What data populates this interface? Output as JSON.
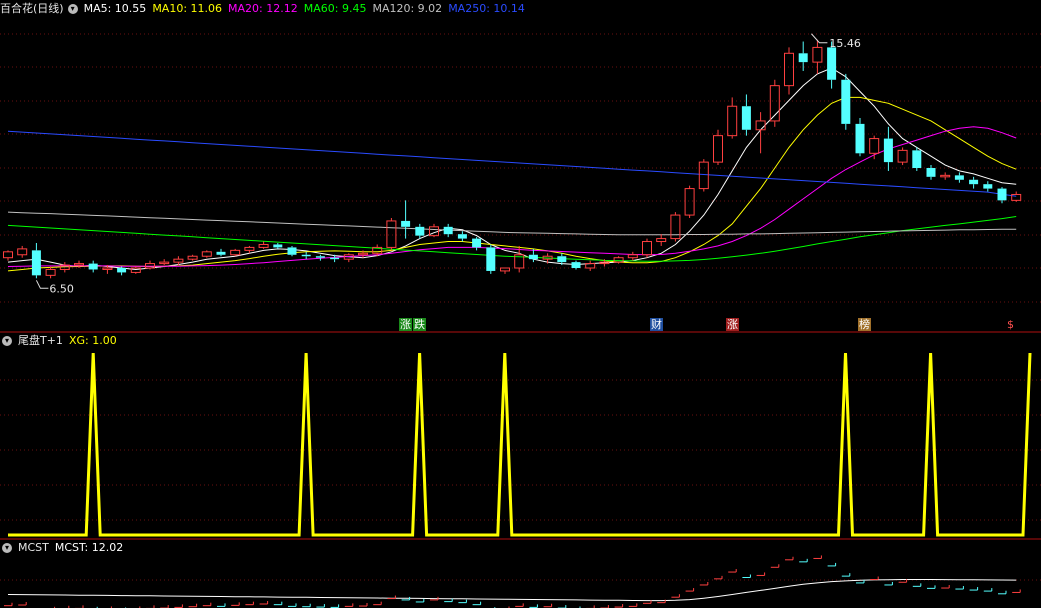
{
  "main_panel": {
    "title": "百合花(日线)",
    "ma": [
      {
        "label": "MA5: 10.55",
        "color": "#ffffff"
      },
      {
        "label": "MA10: 11.06",
        "color": "#ffff00"
      },
      {
        "label": "MA20: 12.12",
        "color": "#ff00ff"
      },
      {
        "label": "MA60: 9.45",
        "color": "#00ff00"
      },
      {
        "label": "MA120: 9.02",
        "color": "#c0c0c0"
      },
      {
        "label": "MA250: 10.14",
        "color": "#2a4bff"
      }
    ],
    "high_label": "15.46",
    "low_label": "6.50",
    "events": [
      {
        "text": "涨",
        "color": "#ffffff",
        "bg": "#1a8a1a"
      },
      {
        "text": "跌",
        "color": "#ffffff",
        "bg": "#1a8a1a"
      },
      {
        "text": "财",
        "color": "#ffffff",
        "bg": "#1f4fa0"
      },
      {
        "text": "涨",
        "color": "#ffffff",
        "bg": "#a01f1f"
      },
      {
        "text": "榜",
        "color": "#ffffff",
        "bg": "#a0702a"
      },
      {
        "text": "$",
        "color": "#ff5050",
        "bg": "#000000"
      }
    ]
  },
  "indicator_panel": {
    "title": "尾盘T+1",
    "value_label": "XG: 1.00",
    "value_color": "#ffff00"
  },
  "mcst_panel": {
    "title": "MCST",
    "value_label": "MCST: 12.02",
    "value_color": "#ffffff"
  },
  "chart_data": {
    "type": "candlestick",
    "up_color": "#ff4040",
    "down_color": "#54ffff",
    "ylim": [
      6.0,
      16.2
    ],
    "candles": [
      [
        8.05,
        8.3,
        7.95,
        8.25
      ],
      [
        8.15,
        8.45,
        8.05,
        8.35
      ],
      [
        8.3,
        8.55,
        7.35,
        7.45
      ],
      [
        7.45,
        7.75,
        7.35,
        7.65
      ],
      [
        7.65,
        7.9,
        7.55,
        7.8
      ],
      [
        7.8,
        7.95,
        7.7,
        7.85
      ],
      [
        7.85,
        7.95,
        7.55,
        7.65
      ],
      [
        7.65,
        7.8,
        7.5,
        7.7
      ],
      [
        7.7,
        7.75,
        7.45,
        7.55
      ],
      [
        7.55,
        7.75,
        7.5,
        7.7
      ],
      [
        7.7,
        7.95,
        7.65,
        7.85
      ],
      [
        7.85,
        8.0,
        7.8,
        7.9
      ],
      [
        7.9,
        8.1,
        7.8,
        8.0
      ],
      [
        8.0,
        8.15,
        7.95,
        8.1
      ],
      [
        8.1,
        8.3,
        8.05,
        8.25
      ],
      [
        8.25,
        8.35,
        8.1,
        8.15
      ],
      [
        8.15,
        8.35,
        8.1,
        8.3
      ],
      [
        8.3,
        8.45,
        8.2,
        8.4
      ],
      [
        8.4,
        8.6,
        8.35,
        8.5
      ],
      [
        8.5,
        8.55,
        8.35,
        8.4
      ],
      [
        8.4,
        8.45,
        8.1,
        8.15
      ],
      [
        8.15,
        8.25,
        8.0,
        8.1
      ],
      [
        8.1,
        8.15,
        7.95,
        8.05
      ],
      [
        8.05,
        8.15,
        7.9,
        8.0
      ],
      [
        8.0,
        8.2,
        7.9,
        8.15
      ],
      [
        8.15,
        8.3,
        8.05,
        8.2
      ],
      [
        8.2,
        8.5,
        8.1,
        8.4
      ],
      [
        8.4,
        9.4,
        8.3,
        9.3
      ],
      [
        9.3,
        10.0,
        8.7,
        9.1
      ],
      [
        9.1,
        9.2,
        8.7,
        8.8
      ],
      [
        8.8,
        9.2,
        8.75,
        9.1
      ],
      [
        9.1,
        9.2,
        8.75,
        8.85
      ],
      [
        8.85,
        8.95,
        8.6,
        8.7
      ],
      [
        8.7,
        8.75,
        8.3,
        8.4
      ],
      [
        8.4,
        8.5,
        7.5,
        7.6
      ],
      [
        7.6,
        7.7,
        7.5,
        7.7
      ],
      [
        7.7,
        8.45,
        7.55,
        8.15
      ],
      [
        8.15,
        8.35,
        7.9,
        8.0
      ],
      [
        8.0,
        8.2,
        7.85,
        8.1
      ],
      [
        8.1,
        8.2,
        7.8,
        7.9
      ],
      [
        7.9,
        7.95,
        7.65,
        7.7
      ],
      [
        7.7,
        7.95,
        7.6,
        7.85
      ],
      [
        7.85,
        8.0,
        7.75,
        7.9
      ],
      [
        7.9,
        8.1,
        7.85,
        8.05
      ],
      [
        8.05,
        8.25,
        7.95,
        8.15
      ],
      [
        8.15,
        8.7,
        8.05,
        8.6
      ],
      [
        8.6,
        8.85,
        8.45,
        8.7
      ],
      [
        8.7,
        9.6,
        8.6,
        9.5
      ],
      [
        9.5,
        10.5,
        9.4,
        10.4
      ],
      [
        10.4,
        11.4,
        10.3,
        11.3
      ],
      [
        11.3,
        12.4,
        11.2,
        12.2
      ],
      [
        12.2,
        13.5,
        12.1,
        13.2
      ],
      [
        13.2,
        13.6,
        12.2,
        12.4
      ],
      [
        12.4,
        13.0,
        11.6,
        12.7
      ],
      [
        12.7,
        14.1,
        12.5,
        13.9
      ],
      [
        13.9,
        15.2,
        13.6,
        15.0
      ],
      [
        15.0,
        15.4,
        14.4,
        14.7
      ],
      [
        14.7,
        15.46,
        14.3,
        15.2
      ],
      [
        15.2,
        15.4,
        13.8,
        14.1
      ],
      [
        14.1,
        14.3,
        12.4,
        12.6
      ],
      [
        12.6,
        12.8,
        11.5,
        11.6
      ],
      [
        11.6,
        12.2,
        11.4,
        12.1
      ],
      [
        12.1,
        12.5,
        11.0,
        11.3
      ],
      [
        11.3,
        11.8,
        11.2,
        11.7
      ],
      [
        11.7,
        11.8,
        11.0,
        11.1
      ],
      [
        11.1,
        11.2,
        10.7,
        10.8
      ],
      [
        10.8,
        10.95,
        10.7,
        10.85
      ],
      [
        10.85,
        10.95,
        10.6,
        10.7
      ],
      [
        10.7,
        10.8,
        10.4,
        10.55
      ],
      [
        10.55,
        10.65,
        10.3,
        10.4
      ],
      [
        10.4,
        10.45,
        9.9,
        10.0
      ],
      [
        10.0,
        10.3,
        9.95,
        10.2
      ]
    ],
    "moving_averages": [
      {
        "name": "MA5",
        "color": "#ffffff",
        "values": [
          7.9,
          7.95,
          8.0,
          7.9,
          7.8,
          7.75,
          7.8,
          7.75,
          7.7,
          7.65,
          7.7,
          7.75,
          7.82,
          7.9,
          8.0,
          8.05,
          8.1,
          8.2,
          8.3,
          8.35,
          8.33,
          8.28,
          8.2,
          8.12,
          8.08,
          8.05,
          8.12,
          8.25,
          8.45,
          8.7,
          8.9,
          9.05,
          9.0,
          8.8,
          8.5,
          8.3,
          8.2,
          8.0,
          7.9,
          7.85,
          7.82,
          7.85,
          7.88,
          7.9,
          7.95,
          8.05,
          8.2,
          8.5,
          8.95,
          9.5,
          10.2,
          11.0,
          11.8,
          12.4,
          12.9,
          13.4,
          13.9,
          14.3,
          14.5,
          14.2,
          13.7,
          13.2,
          12.6,
          12.1,
          11.8,
          11.5,
          11.2,
          11.0,
          10.9,
          10.75,
          10.6,
          10.55
        ]
      },
      {
        "name": "MA10",
        "color": "#ffff00",
        "values": [
          7.6,
          7.65,
          7.7,
          7.72,
          7.74,
          7.75,
          7.76,
          7.77,
          7.77,
          7.76,
          7.75,
          7.76,
          7.77,
          7.8,
          7.85,
          7.9,
          7.95,
          8.02,
          8.1,
          8.17,
          8.22,
          8.25,
          8.27,
          8.28,
          8.27,
          8.25,
          8.25,
          8.3,
          8.4,
          8.5,
          8.55,
          8.6,
          8.6,
          8.55,
          8.5,
          8.45,
          8.4,
          8.35,
          8.28,
          8.2,
          8.1,
          8.02,
          7.95,
          7.9,
          7.88,
          7.88,
          7.92,
          8.05,
          8.25,
          8.5,
          8.8,
          9.2,
          9.8,
          10.4,
          11.1,
          11.8,
          12.4,
          12.9,
          13.3,
          13.5,
          13.5,
          13.4,
          13.3,
          13.1,
          12.9,
          12.7,
          12.4,
          12.1,
          11.8,
          11.5,
          11.25,
          11.06
        ]
      },
      {
        "name": "MA20",
        "color": "#ff00ff",
        "values": [
          7.75,
          7.76,
          7.77,
          7.77,
          7.77,
          7.77,
          7.77,
          7.77,
          7.76,
          7.76,
          7.76,
          7.76,
          7.76,
          7.77,
          7.78,
          7.8,
          7.82,
          7.85,
          7.88,
          7.92,
          7.96,
          8.0,
          8.03,
          8.06,
          8.09,
          8.12,
          8.15,
          8.2,
          8.26,
          8.32,
          8.36,
          8.4,
          8.4,
          8.4,
          8.38,
          8.36,
          8.33,
          8.3,
          8.28,
          8.26,
          8.24,
          8.22,
          8.2,
          8.18,
          8.16,
          8.15,
          8.16,
          8.2,
          8.27,
          8.35,
          8.45,
          8.6,
          8.8,
          9.05,
          9.35,
          9.7,
          10.05,
          10.4,
          10.75,
          11.05,
          11.3,
          11.55,
          11.75,
          11.9,
          12.05,
          12.2,
          12.35,
          12.45,
          12.5,
          12.45,
          12.3,
          12.12
        ]
      },
      {
        "name": "MA60",
        "color": "#00ff00",
        "values": [
          9.15,
          9.12,
          9.09,
          9.06,
          9.03,
          9.0,
          8.97,
          8.94,
          8.91,
          8.88,
          8.85,
          8.82,
          8.79,
          8.76,
          8.73,
          8.7,
          8.67,
          8.64,
          8.61,
          8.58,
          8.55,
          8.52,
          8.49,
          8.46,
          8.43,
          8.4,
          8.37,
          8.34,
          8.31,
          8.28,
          8.25,
          8.22,
          8.19,
          8.16,
          8.13,
          8.1,
          8.08,
          8.06,
          8.04,
          8.02,
          8.0,
          7.98,
          7.96,
          7.95,
          7.94,
          7.93,
          7.93,
          7.94,
          7.96,
          7.99,
          8.03,
          8.08,
          8.14,
          8.2,
          8.27,
          8.35,
          8.43,
          8.52,
          8.6,
          8.68,
          8.76,
          8.83,
          8.9,
          8.97,
          9.03,
          9.09,
          9.15,
          9.2,
          9.26,
          9.32,
          9.38,
          9.45
        ]
      },
      {
        "name": "MA120",
        "color": "#c0c0c0",
        "values": [
          9.6,
          9.58,
          9.56,
          9.55,
          9.53,
          9.51,
          9.49,
          9.47,
          9.45,
          9.43,
          9.41,
          9.39,
          9.37,
          9.35,
          9.33,
          9.31,
          9.29,
          9.27,
          9.25,
          9.23,
          9.21,
          9.19,
          9.17,
          9.15,
          9.13,
          9.11,
          9.09,
          9.07,
          9.05,
          9.03,
          9.01,
          8.99,
          8.97,
          8.95,
          8.93,
          8.91,
          8.9,
          8.89,
          8.88,
          8.87,
          8.86,
          8.85,
          8.84,
          8.83,
          8.83,
          8.83,
          8.83,
          8.83,
          8.84,
          8.84,
          8.85,
          8.85,
          8.86,
          8.86,
          8.87,
          8.88,
          8.89,
          8.9,
          8.91,
          8.92,
          8.93,
          8.94,
          8.95,
          8.96,
          8.97,
          8.98,
          8.99,
          9.0,
          9.0,
          9.01,
          9.02,
          9.02
        ]
      },
      {
        "name": "MA250",
        "color": "#2a4bff",
        "values": [
          12.35,
          12.32,
          12.29,
          12.26,
          12.23,
          12.2,
          12.17,
          12.14,
          12.11,
          12.08,
          12.05,
          12.02,
          11.99,
          11.96,
          11.93,
          11.9,
          11.87,
          11.84,
          11.81,
          11.78,
          11.75,
          11.72,
          11.69,
          11.66,
          11.63,
          11.6,
          11.57,
          11.54,
          11.51,
          11.48,
          11.45,
          11.42,
          11.39,
          11.36,
          11.33,
          11.3,
          11.27,
          11.24,
          11.21,
          11.18,
          11.15,
          11.12,
          11.09,
          11.06,
          11.03,
          11.0,
          10.97,
          10.94,
          10.91,
          10.88,
          10.85,
          10.82,
          10.79,
          10.76,
          10.73,
          10.7,
          10.67,
          10.64,
          10.61,
          10.58,
          10.55,
          10.52,
          10.49,
          10.46,
          10.43,
          10.4,
          10.37,
          10.34,
          10.31,
          10.28,
          10.21,
          10.14
        ]
      }
    ],
    "xg_signal_days": [
      6,
      21,
      29,
      35,
      59,
      65,
      72
    ],
    "xg_total_days": 73,
    "mcst": [
      9.9,
      9.88,
      9.86,
      9.84,
      9.82,
      9.8,
      9.78,
      9.76,
      9.74,
      9.72,
      9.7,
      9.68,
      9.66,
      9.64,
      9.62,
      9.6,
      9.58,
      9.56,
      9.54,
      9.52,
      9.5,
      9.48,
      9.46,
      9.44,
      9.42,
      9.4,
      9.38,
      9.36,
      9.34,
      9.32,
      9.3,
      9.28,
      9.26,
      9.24,
      9.22,
      9.2,
      9.18,
      9.16,
      9.14,
      9.12,
      9.1,
      9.08,
      9.06,
      9.04,
      9.02,
      9.0,
      9.0,
      9.05,
      9.15,
      9.35,
      9.6,
      9.9,
      10.2,
      10.5,
      10.8,
      11.1,
      11.4,
      11.6,
      11.8,
      11.9,
      12.0,
      12.05,
      12.08,
      12.1,
      12.1,
      12.1,
      12.09,
      12.08,
      12.06,
      12.05,
      12.03,
      12.02
    ]
  }
}
